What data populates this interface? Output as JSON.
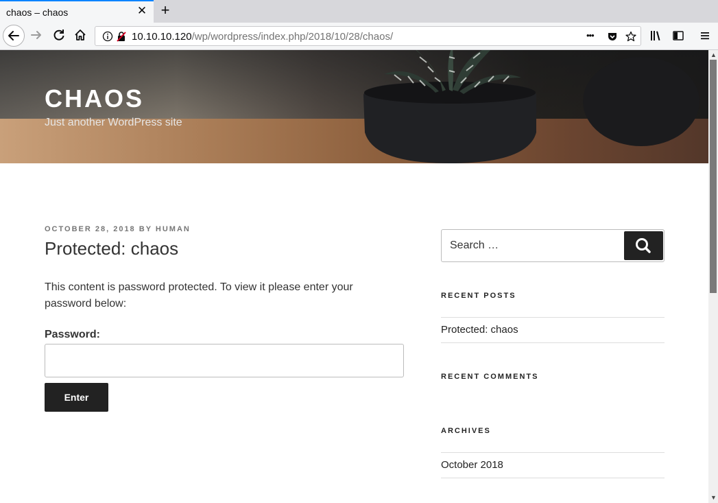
{
  "browser": {
    "tab_title": "chaos – chaos",
    "tab_close": "✕",
    "new_tab": "+",
    "url_host": "10.10.10.120",
    "url_path": "/wp/wordpress/index.php/2018/10/28/chaos/",
    "url_more": "•••"
  },
  "site": {
    "title": "CHAOS",
    "description": "Just another WordPress site"
  },
  "post": {
    "date": "OCTOBER 28, 2018",
    "by": "BY",
    "author": "HUMAN",
    "title": "Protected: chaos",
    "body": "This content is password protected. To view it please enter your password below:",
    "password_label": "Password:",
    "password_value": "",
    "enter_label": "Enter"
  },
  "sidebar": {
    "search_placeholder": "Search …",
    "recent_posts_title": "RECENT POSTS",
    "recent_posts": [
      "Protected: chaos"
    ],
    "recent_comments_title": "RECENT COMMENTS",
    "archives_title": "ARCHIVES",
    "archives": [
      "October 2018"
    ]
  },
  "colors": {
    "accent_tab": "#0a84ff",
    "button_dark": "#222222"
  }
}
